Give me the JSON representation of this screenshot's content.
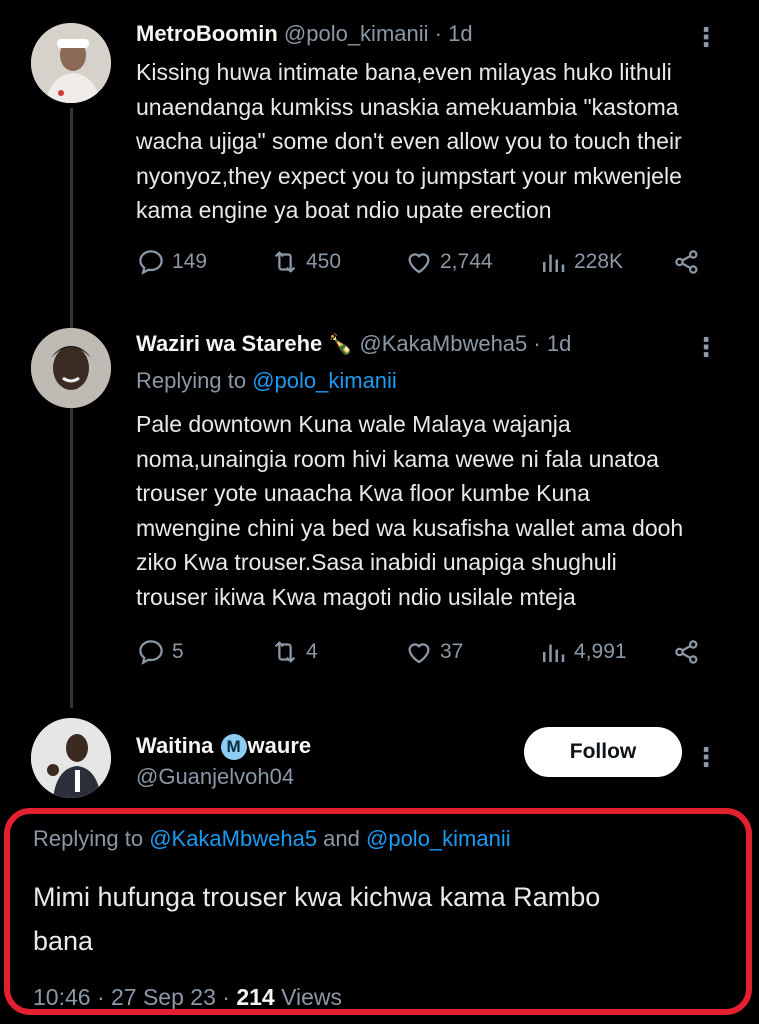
{
  "tweets": [
    {
      "name": "MetroBoomin",
      "handle": "@polo_kimanii",
      "time": "· 1d",
      "body_lines": [
        "Kissing huwa intimate bana,even milayas huko lithuli",
        "unaendanga kumkiss unaskia amekuambia \"kastoma",
        "wacha ujiga\" some don't even allow you to touch their",
        "nyonyoz,they expect you to jumpstart your mkwenjele",
        "kama engine ya boat ndio upate erection"
      ],
      "replies": "149",
      "retweets": "450",
      "likes": "2,744",
      "views": "228K"
    },
    {
      "name": "Waziri wa Starehe",
      "name_emoji": "🍾",
      "handle": "@KakaMbweha5",
      "time": "· 1d",
      "replying_prefix": "Replying to ",
      "replying_to": "@polo_kimanii",
      "body_lines": [
        "Pale downtown Kuna wale Malaya wajanja",
        "noma,unaingia room hivi kama wewe ni fala unatoa",
        "trouser yote unaacha Kwa floor kumbe Kuna",
        "mwengine chini ya bed wa kusafisha wallet ama dooh",
        "ziko Kwa trouser.Sasa inabidi unapiga shughuli",
        "trouser ikiwa Kwa magoti ndio usilale mteja"
      ],
      "replies": "5",
      "retweets": "4",
      "likes": "37",
      "views": "4,991"
    },
    {
      "name_part1": "Waitina ",
      "name_badge": "M",
      "name_part2": "waure",
      "handle": "@Guanjelvoh04",
      "follow_label": "Follow",
      "replying_prefix": "Replying to ",
      "replying_to_1": "@KakaMbweha5",
      "replying_and": " and ",
      "replying_to_2": "@polo_kimanii",
      "body_lines": [
        "Mimi hufunga trouser kwa kichwa kama Rambo",
        "bana"
      ],
      "timestamp": "10:46 · 27 Sep 23 · ",
      "views_count": "214",
      "views_label": " Views"
    }
  ],
  "more_icon": "⋮",
  "colors": {
    "accent": "#1d9bf0",
    "highlight": "#e2202f"
  }
}
